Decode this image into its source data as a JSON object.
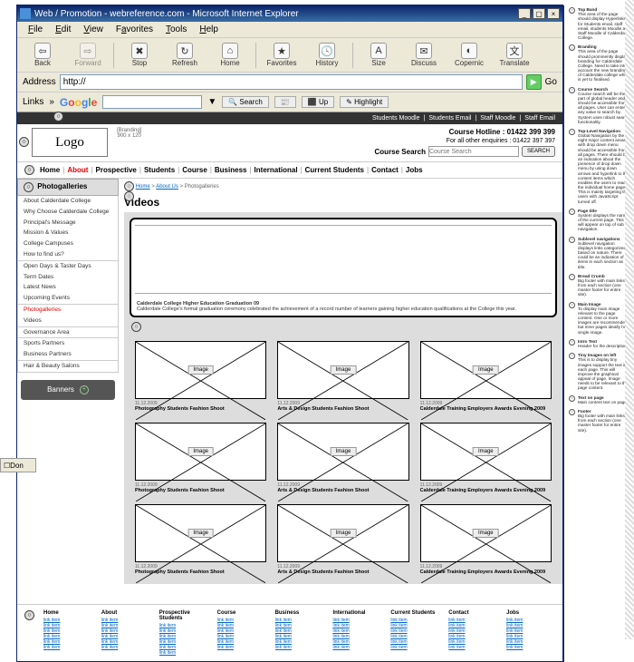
{
  "window": {
    "title": "Web / Promotion - webreference.com - Microsoft Internet Explorer"
  },
  "menu": [
    "File",
    "Edit",
    "View",
    "Favorites",
    "Tools",
    "Help"
  ],
  "tool": {
    "back": "Back",
    "forward": "Forward",
    "stop": "Stop",
    "refresh": "Refresh",
    "home": "Home",
    "favorites": "Favorites",
    "history": "History",
    "size": "Size",
    "discuss": "Discuss",
    "copernic": "Copernic",
    "translate": "Translate"
  },
  "addr": {
    "label": "Address",
    "value": "http://",
    "go": "Go"
  },
  "links": {
    "label": "Links",
    "search": "Search",
    "pop": "Up",
    "hi": "Highlight"
  },
  "topbar": {
    "students_moodle": "Students Moodle",
    "students_email": "Students Email",
    "staff_moodle": "Staff Moodle",
    "staff_email": "Staff Email"
  },
  "branding": {
    "logo": "Logo",
    "tag": "[Branding]",
    "size": "900 x 120"
  },
  "hotline": {
    "label": "Course Hotline :",
    "number": "01422 399 399",
    "sub": "For all other enquiries : 01422 397 397",
    "search_label": "Course Search",
    "placeholder": "Course Search",
    "btn": "SEARCH"
  },
  "nav": [
    "Home",
    "About",
    "Prospective",
    "Students",
    "Course",
    "Business",
    "International",
    "Current Students",
    "Contact",
    "Jobs"
  ],
  "nav_active": 1,
  "side": {
    "heading": "Photogalleries",
    "g1": [
      "About Calderdale College",
      "Why Choose Calderdale College",
      "Principal's Message",
      "Mission & Values",
      "College Campuses",
      "How to find us?"
    ],
    "g2": [
      "Open Days & Taster Days",
      "Term Dates",
      "Latest News",
      "Upcoming Events"
    ],
    "g3": [
      "Photogalleries",
      "Videos"
    ],
    "g4": [
      "Governance Area"
    ],
    "g5": [
      "Sports Partners",
      "Business Partners"
    ],
    "g6": [
      "Hair & Beauty Salons"
    ],
    "banner": "Banners"
  },
  "crumb": {
    "home": "Home",
    "about": "About Us",
    "cur": "Photogalleries"
  },
  "page_title": "Videos",
  "hero": {
    "title": "Calderdale College Higher Education Graduation 09",
    "text": "Calderdale College's formal graduation ceremony celebrated the achievement of a record number of learners gaining higher education qualifications at the College this year."
  },
  "cards": [
    {
      "d": "11.12.2009",
      "t": "Photography Students Fashion Shoot"
    },
    {
      "d": "11.12.2009",
      "t": "Arts & Design Students Fashion Shoot"
    },
    {
      "d": "11.12.2009",
      "t": "Calderdale Training Employers Awards Evening 2009"
    },
    {
      "d": "11.12.2009",
      "t": "Photography Students Fashion Shoot"
    },
    {
      "d": "11.12.2009",
      "t": "Arts & Design Students Fashion Shoot"
    },
    {
      "d": "11.12.2009",
      "t": "Calderdale Training Employers Awards Evening 2009"
    },
    {
      "d": "11.12.2009",
      "t": "Photography Students Fashion Shoot"
    },
    {
      "d": "11.12.2009",
      "t": "Arts & Design Students Fashion Shoot"
    },
    {
      "d": "11.12.2009",
      "t": "Calderdale Training Employers Awards Evening 2009"
    }
  ],
  "img_tag": "Image",
  "footer": [
    "Home",
    "About",
    "Prospective Students",
    "Course",
    "Business",
    "International",
    "Current Students",
    "Contact",
    "Jobs"
  ],
  "legend": [
    {
      "t": "Top Band",
      "d": "This area of the page should display Hyperlinks for Students email, staff email, students Moodle and Staff Moodle of Calderdale College."
    },
    {
      "t": "Branding",
      "d": "This area of the page should prominently display branding for Calderdale College. Need to take into account the new branding of Calderdale college which is yet to finalised."
    },
    {
      "t": "Course Search",
      "d": "Course search will be the part of global header and should be accessible from all pages. User can enter any value to search by. System uses robust search functionality."
    },
    {
      "t": "Top-Level Navigation",
      "d": "Global Navigation by the eight major content areas with drop down menu should be accessible from all pages. There should be an indication about the presence of drop down menu by using down arrows and hyperlink to the content items which enables the users to reach the individual home pages. This is mainly targeting the users with JavaScript turned off."
    },
    {
      "t": "Page title",
      "d": "System displays the name of the current page. This will appear on top of sub navigation."
    },
    {
      "t": "Sublevel navigations",
      "d": "Sublevel navigation displays links categorized based on nature. There could be an indication of items in each section as title."
    },
    {
      "t": "Bread Crumb",
      "d": "Big footer with main links from each section (one master footer for entire site)."
    },
    {
      "t": "Main Image",
      "d": "To display main image relevant to the page content. One or more images are recommended but inner pages ideally hold single image."
    },
    {
      "t": "Intro Text",
      "d": "Header for the description"
    },
    {
      "t": "Tiny Images on left",
      "d": "This is to display tiny images support the text in each page. This will improve the graphical appeal of page. Image needs to be relevant to the page content."
    },
    {
      "t": "Text on page",
      "d": "Main content text on pages."
    },
    {
      "t": "Footer",
      "d": "Big footer with main links from each section (one master footer for entire site)."
    }
  ],
  "status": "Don"
}
